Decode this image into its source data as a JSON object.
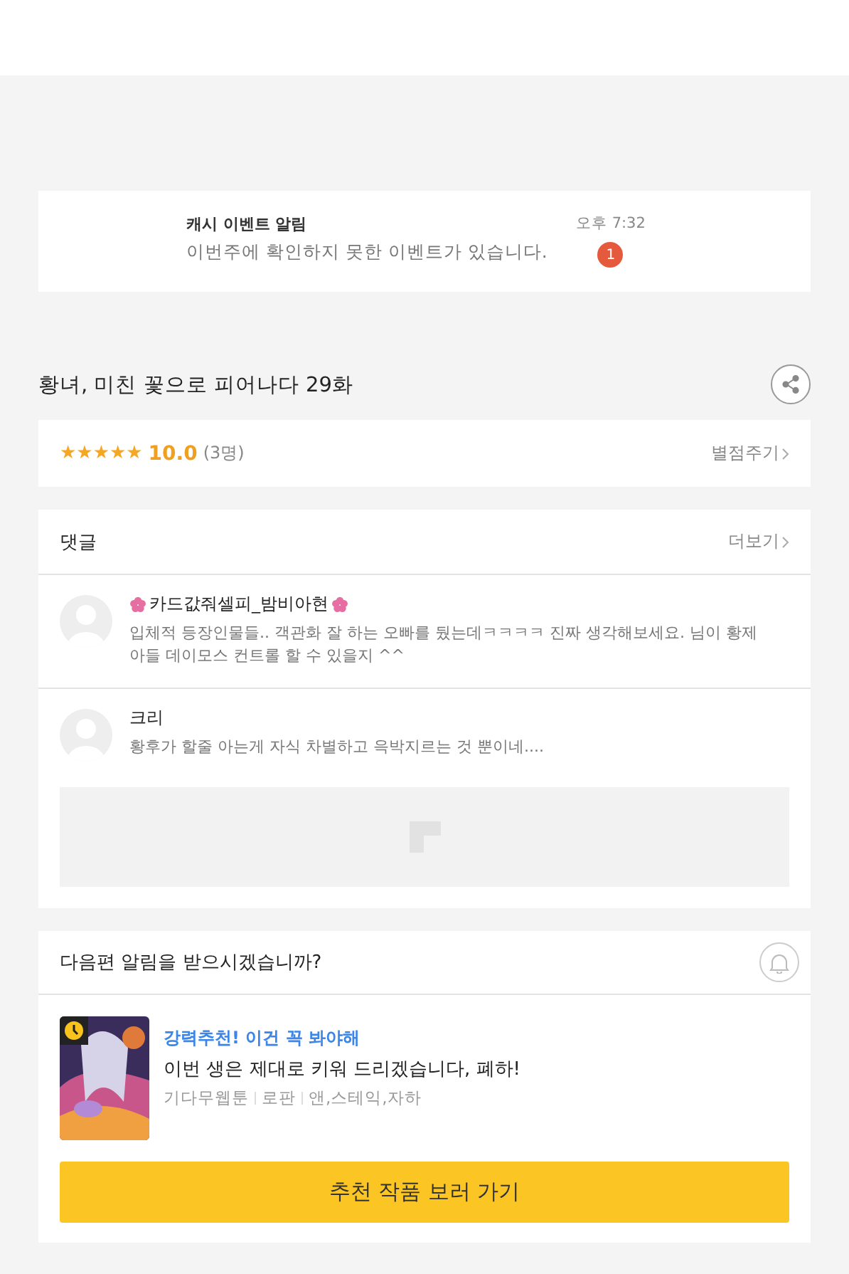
{
  "notification": {
    "title": "캐시 이벤트 알림",
    "message": "이번주에 확인하지 못한 이벤트가 있습니다.",
    "time": "오후 7:32",
    "badge": "1"
  },
  "episode": {
    "title": "황녀, 미친 꽃으로 피어나다 29화"
  },
  "rating": {
    "stars": 5,
    "score": "10.0",
    "count": "(3명)",
    "action": "별점주기"
  },
  "comments": {
    "title": "댓글",
    "more": "더보기",
    "items": [
      {
        "author": "카드값줘셀피_밤비아현",
        "lines": [
          "입체적 등장인물들.. 객관화 잘 하는 오빠를 뒀는데ㅋㅋㅋㅋ 진짜 생각해보세요. 님이 황제",
          "아들 데이모스 컨트롤 할 수 있을지 ^^"
        ],
        "flowers": true
      },
      {
        "author": "크리",
        "lines": [
          "황후가 할줄 아는게 자식 차별하고 윽박지르는 것 뿐이네...."
        ],
        "flowers": false
      }
    ]
  },
  "subscribe": {
    "question": "다음편 알림을 받으시겠습니까?",
    "recommendation": {
      "tag": "강력추천! 이건 꼭 봐야해",
      "title": "이번 생은 제대로 키워 드리겠습니다, 폐하!",
      "meta": [
        "기다무웹툰",
        "로판",
        "앤,스테익,자하"
      ]
    },
    "button": "추천 작품 보러 가기"
  }
}
